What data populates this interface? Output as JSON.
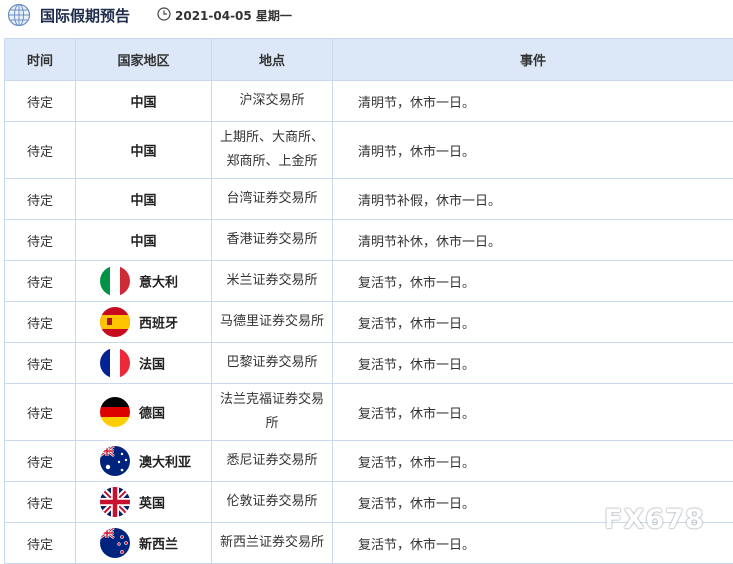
{
  "header": {
    "title": "国际假期预告",
    "date": "2021-04-05 星期一"
  },
  "table": {
    "columns": [
      "时间",
      "国家地区",
      "地点",
      "事件"
    ],
    "rows": [
      {
        "time": "待定",
        "country": "中国",
        "flag": "none",
        "place": "沪深交易所",
        "event": "清明节，休市一日。"
      },
      {
        "time": "待定",
        "country": "中国",
        "flag": "none",
        "place": "上期所、大商所、郑商所、上金所",
        "event": "清明节，休市一日。"
      },
      {
        "time": "待定",
        "country": "中国",
        "flag": "none",
        "place": "台湾证券交易所",
        "event": "清明节补假，休市一日。"
      },
      {
        "time": "待定",
        "country": "中国",
        "flag": "none",
        "place": "香港证券交易所",
        "event": "清明节补休，休市一日。"
      },
      {
        "time": "待定",
        "country": "意大利",
        "flag": "italy-flag-icon",
        "place": "米兰证券交易所",
        "event": "复活节，休市一日。"
      },
      {
        "time": "待定",
        "country": "西班牙",
        "flag": "spain-flag-icon",
        "place": "马德里证券交易所",
        "event": "复活节，休市一日。"
      },
      {
        "time": "待定",
        "country": "法国",
        "flag": "france-flag-icon",
        "place": "巴黎证券交易所",
        "event": "复活节，休市一日。"
      },
      {
        "time": "待定",
        "country": "德国",
        "flag": "germany-flag-icon",
        "place": "法兰克福证券交易所",
        "event": "复活节，休市一日。"
      },
      {
        "time": "待定",
        "country": "澳大利亚",
        "flag": "australia-flag-icon",
        "place": "悉尼证券交易所",
        "event": "复活节，休市一日。"
      },
      {
        "time": "待定",
        "country": "英国",
        "flag": "uk-flag-icon",
        "place": "伦敦证券交易所",
        "event": "复活节，休市一日。"
      },
      {
        "time": "待定",
        "country": "新西兰",
        "flag": "new-zealand-flag-icon",
        "place": "新西兰证券交易所",
        "event": "复活节，休市一日。"
      }
    ]
  },
  "watermark": "FX678",
  "colors": {
    "header_bg": "#dce8f7",
    "border": "#c9d9ee",
    "title": "#1e2c4c"
  }
}
